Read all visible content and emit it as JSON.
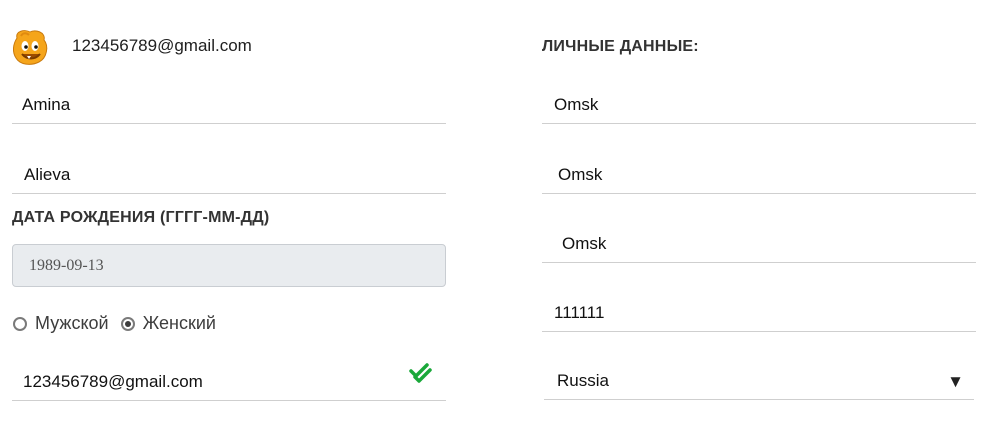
{
  "header": {
    "avatar_icon": "cartoon-face-icon",
    "email": "123456789@gmail.com"
  },
  "left": {
    "first_name": "Amina",
    "last_name": "Alieva",
    "birthdate_heading": "ДАТА РОЖДЕНИЯ (ГГГГ-ММ-ДД)",
    "birthdate_value": "1989-09-13",
    "gender": {
      "options": [
        "Мужской",
        "Женский"
      ],
      "selected": "Женский"
    },
    "email": "123456789@gmail.com",
    "email_status_icon": "double-check-icon",
    "accent_color": "#1aa83a"
  },
  "right": {
    "personal_heading": "ЛИЧНЫЕ ДАННЫЕ:",
    "field_1": "Omsk",
    "field_2": "Omsk",
    "field_3": "Omsk",
    "postal_code": "111111",
    "country": "Russia",
    "country_dropdown_icon": "triangle-down-icon"
  }
}
